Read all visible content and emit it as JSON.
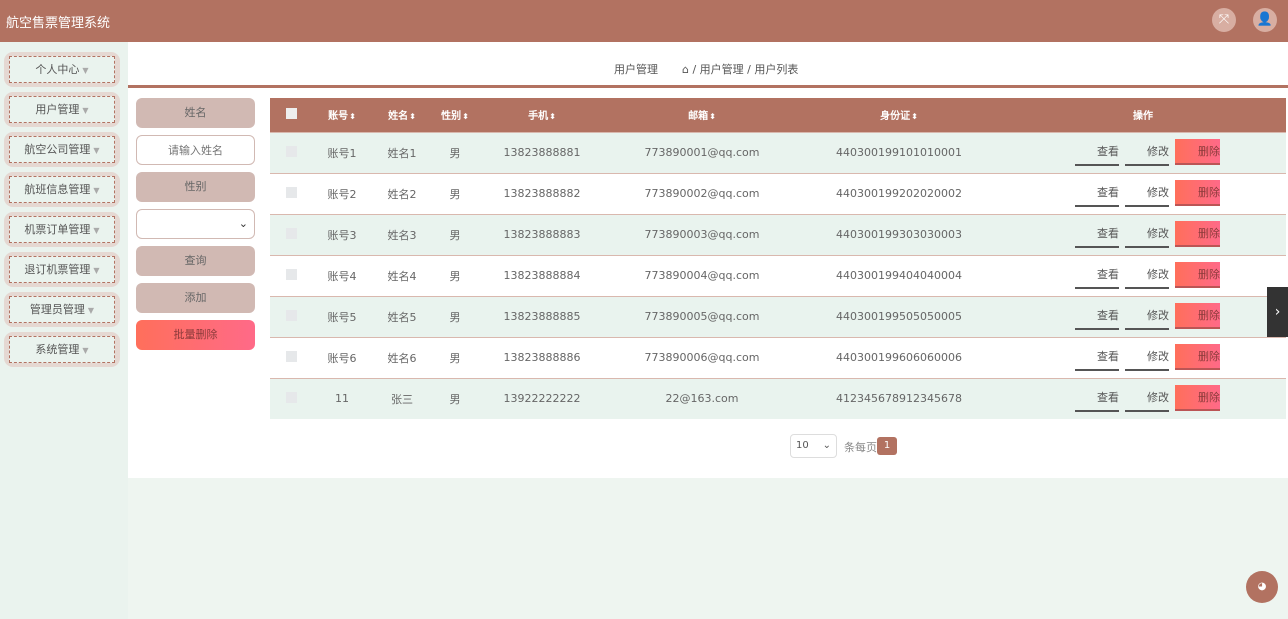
{
  "app": {
    "title": "航空售票管理系统"
  },
  "sidebar": {
    "items": [
      {
        "label": "个人中心"
      },
      {
        "label": "用户管理"
      },
      {
        "label": "航空公司管理"
      },
      {
        "label": "航班信息管理"
      },
      {
        "label": "机票订单管理"
      },
      {
        "label": "退订机票管理"
      },
      {
        "label": "管理员管理"
      },
      {
        "label": "系统管理"
      }
    ]
  },
  "breadcrumb": {
    "title": "用户管理",
    "path": "/ 用户管理 / 用户列表"
  },
  "filters": {
    "name_label": "姓名",
    "name_placeholder": "请输入姓名",
    "gender_label": "性别",
    "query": "查询",
    "add": "添加",
    "batch_delete": "批量删除"
  },
  "table": {
    "columns": [
      "账号",
      "姓名",
      "性别",
      "手机",
      "邮箱",
      "身份证",
      "操作"
    ],
    "rows": [
      [
        "账号1",
        "姓名1",
        "男",
        "13823888881",
        "773890001@qq.com",
        "440300199101010001"
      ],
      [
        "账号2",
        "姓名2",
        "男",
        "13823888882",
        "773890002@qq.com",
        "440300199202020002"
      ],
      [
        "账号3",
        "姓名3",
        "男",
        "13823888883",
        "773890003@qq.com",
        "440300199303030003"
      ],
      [
        "账号4",
        "姓名4",
        "男",
        "13823888884",
        "773890004@qq.com",
        "440300199404040004"
      ],
      [
        "账号5",
        "姓名5",
        "男",
        "13823888885",
        "773890005@qq.com",
        "440300199505050005"
      ],
      [
        "账号6",
        "姓名6",
        "男",
        "13823888886",
        "773890006@qq.com",
        "440300199606060006"
      ],
      [
        "11",
        "张三",
        "男",
        "13922222222",
        "22@163.com",
        "412345678912345678"
      ]
    ],
    "view": "查看",
    "edit": "修改",
    "delete": "删除"
  },
  "pagination": {
    "page_size": "10",
    "per_page_label": "条每页",
    "current_page": "1"
  }
}
